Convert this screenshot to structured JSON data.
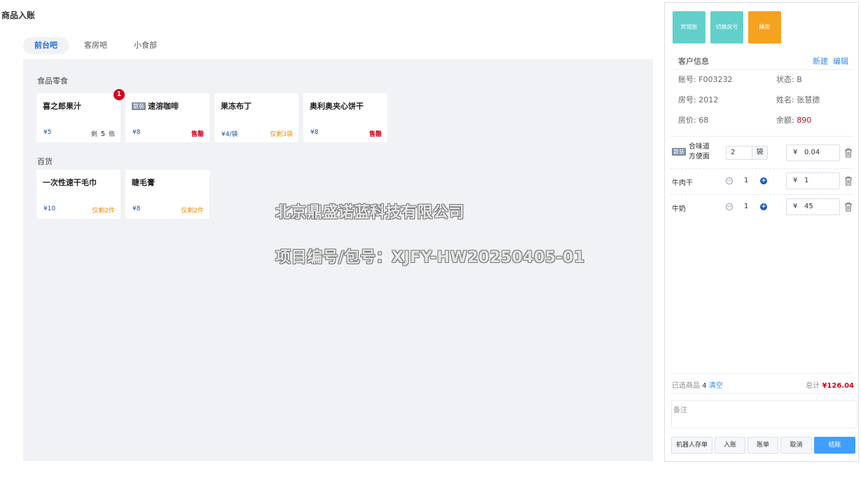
{
  "page_title": "商品入账",
  "tabs": [
    {
      "label": "前台吧",
      "active": true
    },
    {
      "label": "客房吧",
      "active": false
    },
    {
      "label": "小食部",
      "active": false
    }
  ],
  "sections": [
    {
      "title": "食品零食",
      "products": [
        {
          "name": "喜之郎果汁",
          "price": "¥5",
          "stock_prefix": "剩",
          "stock_num": "5",
          "stock_unit": "瓶",
          "badge": "1"
        },
        {
          "tag": "散装",
          "name": "速溶咖啡",
          "price": "¥8",
          "stock": "售罄",
          "status": "out"
        },
        {
          "name": "果冻布丁",
          "price": "¥4/袋",
          "stock": "仅剩3袋",
          "status": "warn"
        },
        {
          "name": "奥利奥夹心饼干",
          "price": "¥8",
          "stock": "售罄",
          "status": "out"
        }
      ]
    },
    {
      "title": "百货",
      "products": [
        {
          "name": "一次性速干毛巾",
          "price": "¥10",
          "stock": "仅剩2件",
          "status": "warn"
        },
        {
          "name": "睫毛膏",
          "price": "¥8",
          "stock": "仅剩2件",
          "status": "warn"
        }
      ]
    }
  ],
  "watermark": {
    "company": "北京鼎盛诺蓝科技有限公司",
    "project": "项目编号/包号：XJFY-HW20250405-01"
  },
  "panel": {
    "actions": [
      {
        "label": "宾馆账",
        "color": "#62cfcb"
      },
      {
        "label": "切换房号",
        "color": "#62cfcb"
      },
      {
        "label": "睡房",
        "color": "#f5a21f"
      }
    ],
    "customer": {
      "title": "客户信息",
      "new_label": "新建",
      "edit_label": "编辑",
      "account": "账号: F003232",
      "status": "状态: B",
      "room": "房号: 2012",
      "name": "姓名: 张慧德",
      "room_price": "房价: 68",
      "balance_label": "余额: ",
      "balance_value": "890"
    },
    "cart": [
      {
        "tag": "散装",
        "name_line1": "合味道",
        "name_line2": "方便面",
        "qty": "2",
        "unit": "袋",
        "currency": "¥",
        "price": "0.04"
      },
      {
        "name": "牛肉干",
        "qty": "1",
        "currency": "¥",
        "price": "1"
      },
      {
        "name": "牛奶",
        "qty": "1",
        "currency": "¥",
        "price": "45"
      }
    ],
    "summary": {
      "selected_label": "已选商品",
      "selected_count": "4",
      "clear_label": "清空",
      "total_label": "总计",
      "total_value": "¥126.04"
    },
    "remark_placeholder": "备注",
    "footer_buttons": [
      "机器人存单",
      "入账",
      "账单",
      "取消",
      "结账"
    ]
  },
  "colors": {
    "accent": "#409eff",
    "teal": "#62cfcb",
    "orange": "#f5a21f",
    "danger": "#d0021b",
    "warn": "#e8900f",
    "content_bg": "#f0f2f5"
  }
}
